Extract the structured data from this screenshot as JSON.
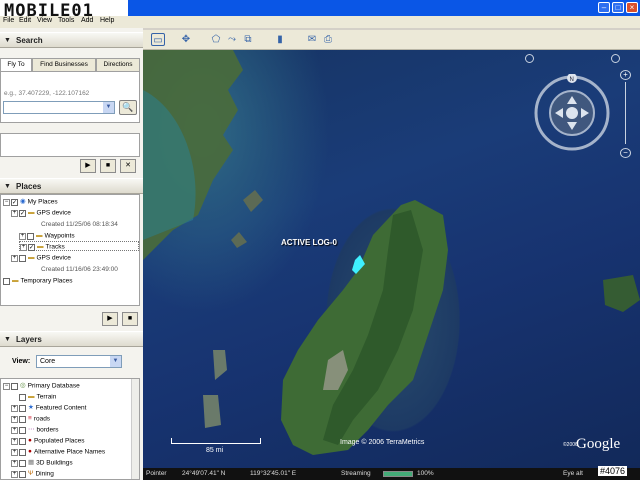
{
  "watermark": {
    "logo_text": "MOBILE01",
    "id_tag": "#4076"
  },
  "menu": [
    "File",
    "Edit",
    "View",
    "Tools",
    "Add",
    "Help"
  ],
  "search": {
    "header": "Search",
    "tabs": [
      "Fly To",
      "Find Businesses",
      "Directions"
    ],
    "hint": "e.g., 37.407229, -122.107162",
    "value": ""
  },
  "places": {
    "header": "Places",
    "items": [
      {
        "label": "My Places",
        "level": 0,
        "expander": "-",
        "checked": true,
        "icon": "globe-icon"
      },
      {
        "label": "GPS device",
        "level": 1,
        "expander": "+",
        "checked": true,
        "icon": "folder-icon"
      },
      {
        "label": "Created 11/25/06 08:18:34",
        "level": 2,
        "sub": true
      },
      {
        "label": "Waypoints",
        "level": 1,
        "expander": "+",
        "checked": false,
        "icon": "folder-icon"
      },
      {
        "label": "Tracks",
        "level": 1,
        "expander": "+",
        "checked": true,
        "icon": "folder-icon",
        "highlight": true
      },
      {
        "label": "GPS device",
        "level": 1,
        "expander": "+",
        "checked": false,
        "icon": "folder-icon"
      },
      {
        "label": "Created 11/16/06 23:49:00",
        "level": 2,
        "sub": true
      },
      {
        "label": "Temporary Places",
        "level": 0,
        "checked": false,
        "icon": "folder-icon"
      }
    ]
  },
  "layers": {
    "header": "Layers",
    "view_label": "View:",
    "view_value": "Core",
    "items": [
      {
        "label": "Primary Database",
        "expander": "-",
        "checked": false,
        "icon": "db-icon"
      },
      {
        "label": "Terrain",
        "checked": false,
        "icon": "folder-icon"
      },
      {
        "label": "Featured Content",
        "expander": "+",
        "checked": false,
        "icon": "star-icon"
      },
      {
        "label": "roads",
        "expander": "+",
        "checked": false,
        "icon": "road-icon"
      },
      {
        "label": "borders",
        "expander": "+",
        "checked": false,
        "icon": "border-icon"
      },
      {
        "label": "Populated Places",
        "expander": "+",
        "checked": false,
        "icon": "dot-icon"
      },
      {
        "label": "Alternative Place Names",
        "expander": "+",
        "checked": false,
        "icon": "dot-icon"
      },
      {
        "label": "3D Buildings",
        "expander": "+",
        "checked": false,
        "icon": "building-icon"
      },
      {
        "label": "Dining",
        "expander": "+",
        "checked": false,
        "icon": "fork-icon"
      }
    ]
  },
  "map": {
    "track_label": "ACTIVE LOG-0",
    "scale_label": "85 mi",
    "copyright": "Image © 2006 TerraMetrics",
    "brand": "Google",
    "brand_prefix": "©2006"
  },
  "status": {
    "pointer_label": "Pointer",
    "lat": "24°49'07.41\" N",
    "lon": "119°32'45.01\" E",
    "streaming_label": "Streaming",
    "streaming_value": "100%",
    "eye_alt_label": "Eye alt"
  },
  "colors": {
    "sea": "#1a3c78",
    "land": "#3e6b35",
    "track": "#3ff0ff",
    "titlebar": "#0a56e6"
  }
}
